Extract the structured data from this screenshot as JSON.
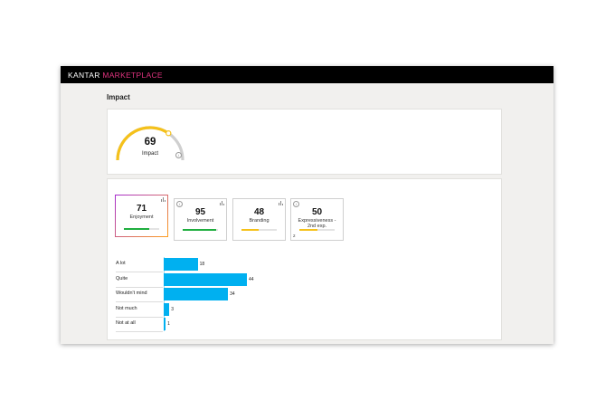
{
  "brand": {
    "part1": "KANTAR ",
    "part2": "MARKETPLACE",
    "accent": "#e0337f"
  },
  "page": {
    "title": "Impact"
  },
  "impact": {
    "value": "69",
    "label": "Impact",
    "score_fraction": 0.69,
    "arc_color": "#f5c11a",
    "track_color": "#cfcfcf"
  },
  "metrics": [
    {
      "value": "71",
      "label": "Enjoyment",
      "fill": 0.71,
      "color": "#1fae3f",
      "active": true,
      "icon": "bar-chart-icon"
    },
    {
      "value": "95",
      "label": "Involvement",
      "fill": 0.95,
      "color": "#1fae3f",
      "active": false,
      "icon": "bar-chart-icon"
    },
    {
      "value": "48",
      "label": "Branding",
      "fill": 0.48,
      "color": "#f5c11a",
      "active": false,
      "icon": "bar-chart-icon"
    },
    {
      "value": "50",
      "label": "Expressiveness - 2nd exp.",
      "fill": 0.5,
      "color": "#f5c11a",
      "active": false,
      "icon": "none",
      "badge": "2"
    }
  ],
  "chart_data": {
    "type": "bar",
    "categories": [
      "A lot",
      "Quite",
      "Wouldn't mind",
      "Not much",
      "Not at all"
    ],
    "values": [
      18,
      44,
      34,
      3,
      1
    ],
    "bar_color": "#00b0f0"
  }
}
